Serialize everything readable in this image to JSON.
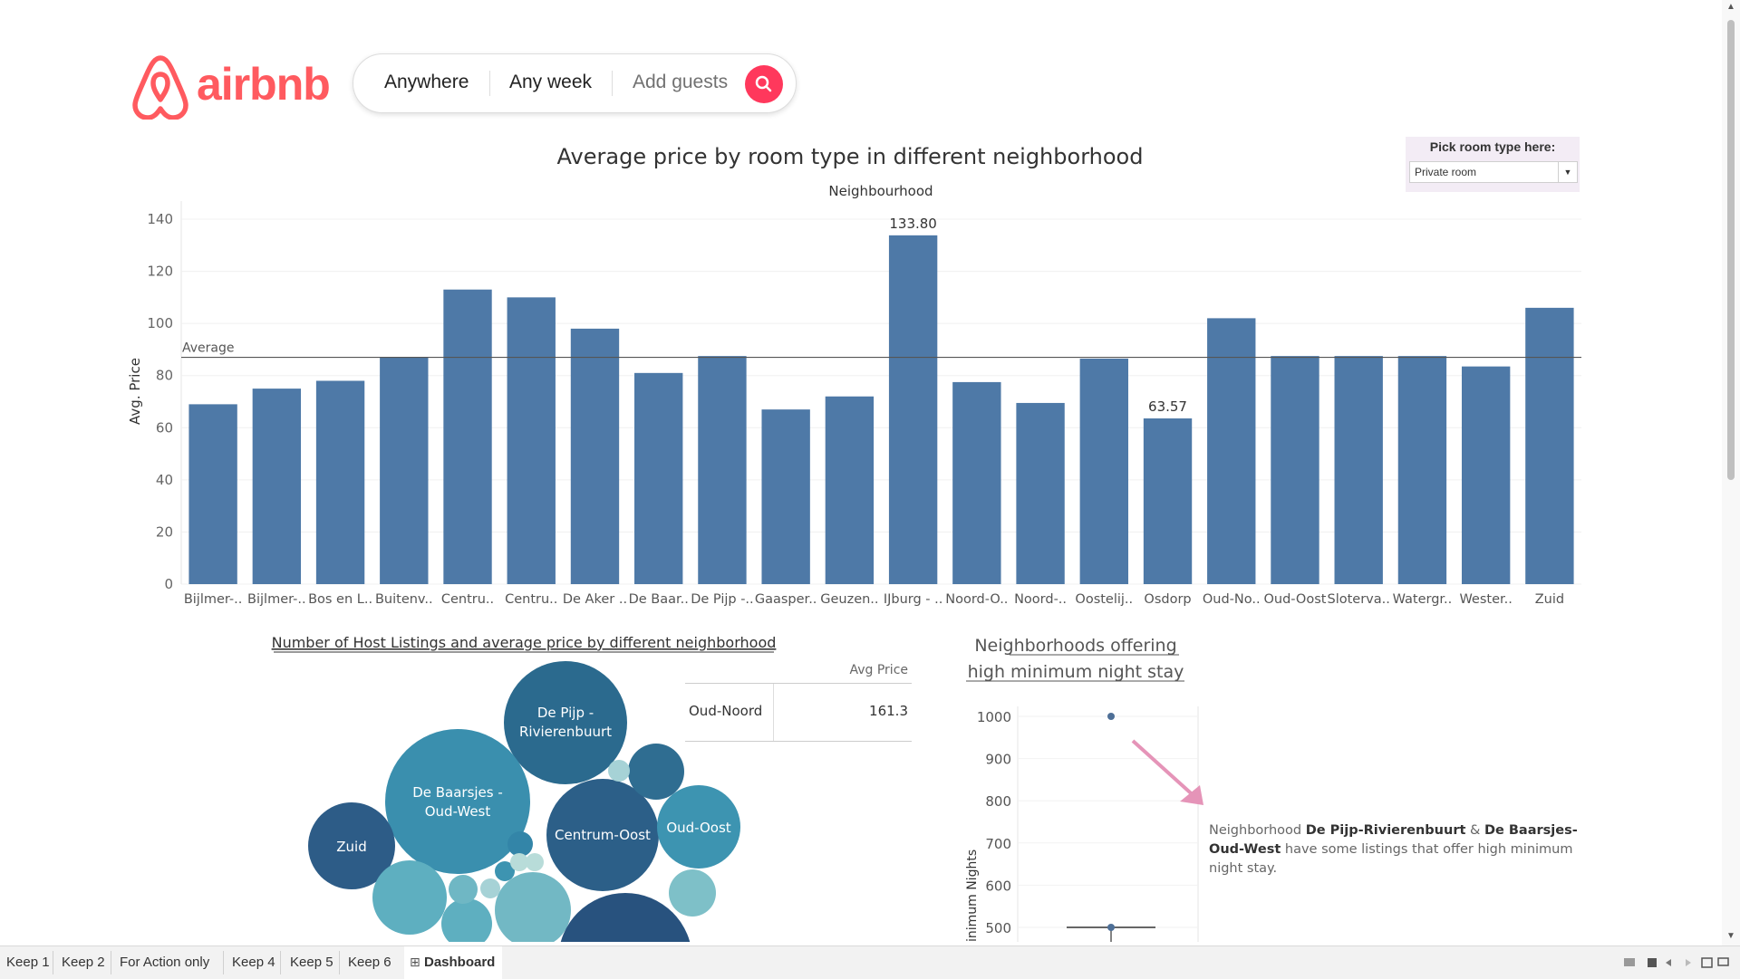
{
  "header": {
    "logo_text": "airbnb",
    "search": {
      "anywhere": "Anywhere",
      "any_week": "Any week",
      "add_guests": "Add guests"
    },
    "brand_color": "#FF5A5F"
  },
  "filter": {
    "title": "Pick room type here:",
    "value": "Private room"
  },
  "main_chart": {
    "title": "Average price by room type in different neighborhood",
    "column_header": "Neighbourhood"
  },
  "chart_data": [
    {
      "type": "bar",
      "title": "Average price by room type in different neighborhood",
      "xlabel": "Neighbourhood",
      "ylabel": "Avg. Price",
      "ylim": [
        0,
        140
      ],
      "yticks": [
        0,
        20,
        40,
        60,
        80,
        100,
        120,
        140
      ],
      "categories": [
        "Bijlmer-..",
        "Bijlmer-..",
        "Bos en L..",
        "Buitenv..",
        "Centru..",
        "Centru..",
        "De Aker ..",
        "De Baar..",
        "De Pijp -..",
        "Gaasper..",
        "Geuzen..",
        "IJburg - ..",
        "Noord-O..",
        "Noord-..",
        "Oostelij..",
        "Osdorp",
        "Oud-No..",
        "Oud-Oost",
        "Slotervа..",
        "Watergr..",
        "Wester..",
        "Zuid"
      ],
      "values": [
        69,
        75,
        78,
        87,
        113,
        110,
        98,
        81,
        87.5,
        67,
        72,
        133.8,
        77.5,
        69.5,
        86.5,
        63.57,
        102,
        87.5,
        87.5,
        87.5,
        83.5,
        106
      ],
      "data_labels": {
        "11": "133.80",
        "15": "63.57"
      },
      "reference_line": {
        "label": "Average",
        "value": 87
      },
      "bar_color": "#4e79a7",
      "grid": true
    },
    {
      "type": "bubble",
      "title": "Number of Host Listings and average price by different neighborhood",
      "labels": [
        "De Pijp - Rivierenbuurt",
        "De Baarsjes - Oud-West",
        "Centrum-Oost",
        "Zuid",
        "Oud-Oost"
      ]
    },
    {
      "type": "scatter",
      "title": "Neighborhoods offering high minimum night stay",
      "ylabel": "Minimum Nights",
      "yticks": [
        500,
        600,
        700,
        800,
        900,
        1000
      ],
      "points": [
        {
          "y": 1000
        },
        {
          "y": 500
        }
      ]
    }
  ],
  "bubble_chart": {
    "title": "Number of Host Listings and average price by different neighborhood",
    "labels": {
      "de_pijp": "De Pijp - Rivierenbuurt",
      "baarsjes": "De Baarsjes - Oud-West",
      "centrum_oost": "Centrum-Oost",
      "zuid": "Zuid",
      "oud_oost": "Oud-Oost"
    }
  },
  "table": {
    "header": "Avg Price",
    "label": "Oud-Noord",
    "value": "161.3"
  },
  "min_nights": {
    "title_line1": "Neighborhoods offering",
    "title_line2": "high minimum night stay ",
    "ylabel": "Minimum Nights"
  },
  "annotation": {
    "prefix": "Neighborhood ",
    "bold1": "De Pijp-Rivierenbuurt",
    "mid": " & ",
    "bold2": "De Baarsjes-Oud-West",
    "suffix": " have some listings that offer high minimum night stay."
  },
  "tabs": [
    "Keep 1",
    "Keep 2",
    "For Action only",
    "Keep 4",
    "Keep 5",
    "Keep 6",
    "Dashboard"
  ],
  "active_tab": "Dashboard"
}
